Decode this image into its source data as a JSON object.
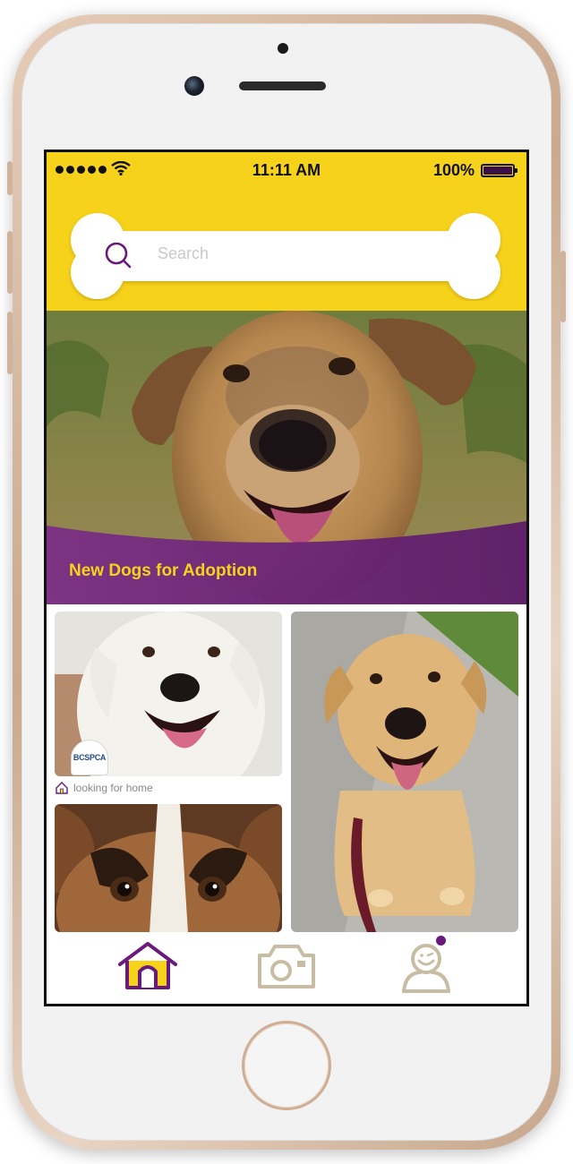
{
  "status_bar": {
    "time": "11:11 AM",
    "battery": "100%"
  },
  "search": {
    "placeholder": "Search"
  },
  "hero": {
    "title": "New Dogs for Adoption"
  },
  "cards": [
    {
      "badge": "BCSPCA",
      "status": "looking for home"
    }
  ],
  "tabbar": {
    "items": [
      {
        "icon": "home-icon",
        "active": true
      },
      {
        "icon": "camera-icon",
        "active": false
      },
      {
        "icon": "profile-icon",
        "active": false,
        "notification": true
      }
    ]
  },
  "colors": {
    "brand_yellow": "#f7d21b",
    "brand_purple": "#6a1a7c",
    "inactive_icon": "#c8bda2"
  }
}
